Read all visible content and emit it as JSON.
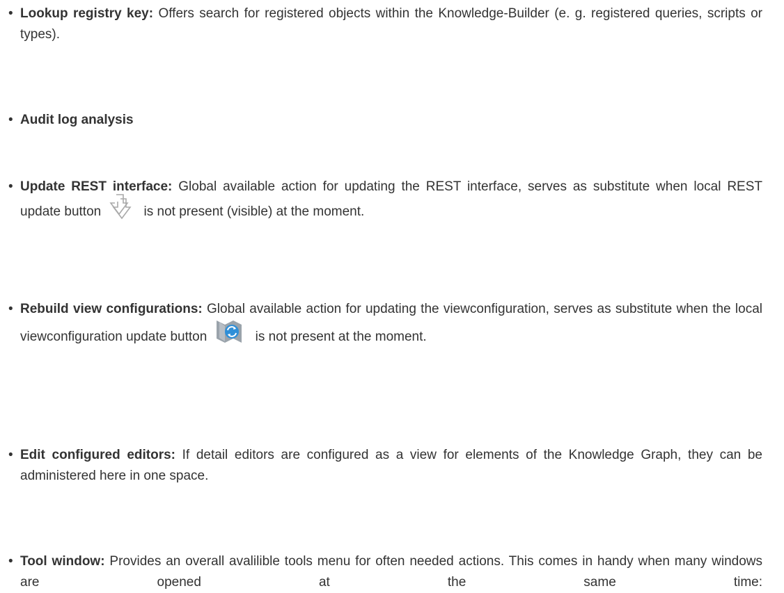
{
  "items": [
    {
      "term": "Lookup registry key:",
      "text": " Offers search for registered objects within the Knowledge-Builder (e. g. registered queries, scripts or types)."
    },
    {
      "term": "Audit log analysis",
      "text": ""
    },
    {
      "term": "Update REST interface:",
      "text_before_icon": " Global available action for updating the REST interface, serves as substitute when local REST update button",
      "icon": "rest-update-arrow-icon",
      "text_after_icon": "is not present (visible) at the moment."
    },
    {
      "term": "Rebuild view configurations:",
      "text_before_icon": " Global available action for updating the viewconfiguration, serves as substitute when the local viewconfiguration update button",
      "icon": "viewconfig-refresh-icon",
      "text_after_icon": "is not present at the moment."
    },
    {
      "term": "Edit configured editors:",
      "text": " If detail editors are configured as a view for elements of the Knowledge Graph, they can be administered here in one space."
    },
    {
      "term": "Tool window:",
      "text": " Provides an overall avalilible tools menu for often needed actions. This comes in handy when many windows are opened at the same time:"
    }
  ],
  "colors": {
    "text": "#333333",
    "icon_gray": "#a9a9a9",
    "icon_blue": "#2f8fd8"
  }
}
